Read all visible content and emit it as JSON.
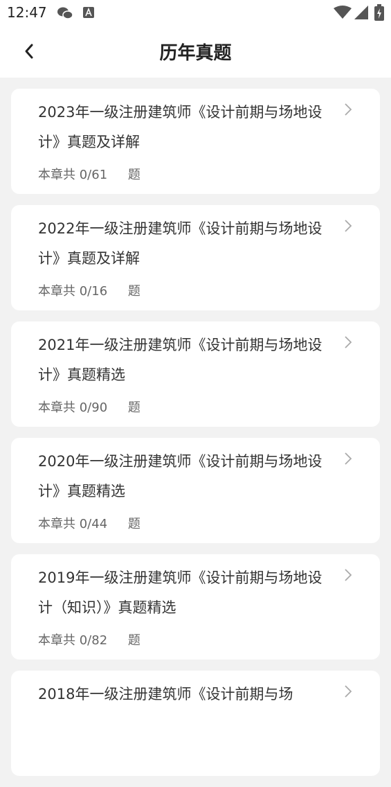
{
  "status_bar": {
    "time": "12:47"
  },
  "header": {
    "title": "历年真题"
  },
  "cards": [
    {
      "title": "2023年一级注册建筑师《设计前期与场地设计》真题及详解",
      "meta_prefix": "本章共",
      "progress": "0/61",
      "meta_suffix": "题"
    },
    {
      "title": "2022年一级注册建筑师《设计前期与场地设计》真题及详解",
      "meta_prefix": "本章共",
      "progress": "0/16",
      "meta_suffix": "题"
    },
    {
      "title": "2021年一级注册建筑师《设计前期与场地设计》真题精选",
      "meta_prefix": "本章共",
      "progress": "0/90",
      "meta_suffix": "题"
    },
    {
      "title": "2020年一级注册建筑师《设计前期与场地设计》真题精选",
      "meta_prefix": "本章共",
      "progress": "0/44",
      "meta_suffix": "题"
    },
    {
      "title": "2019年一级注册建筑师《设计前期与场地设计（知识）》真题精选",
      "meta_prefix": "本章共",
      "progress": "0/82",
      "meta_suffix": "题"
    },
    {
      "title": "2018年一级注册建筑师《设计前期与场",
      "meta_prefix": "",
      "progress": "",
      "meta_suffix": ""
    }
  ]
}
